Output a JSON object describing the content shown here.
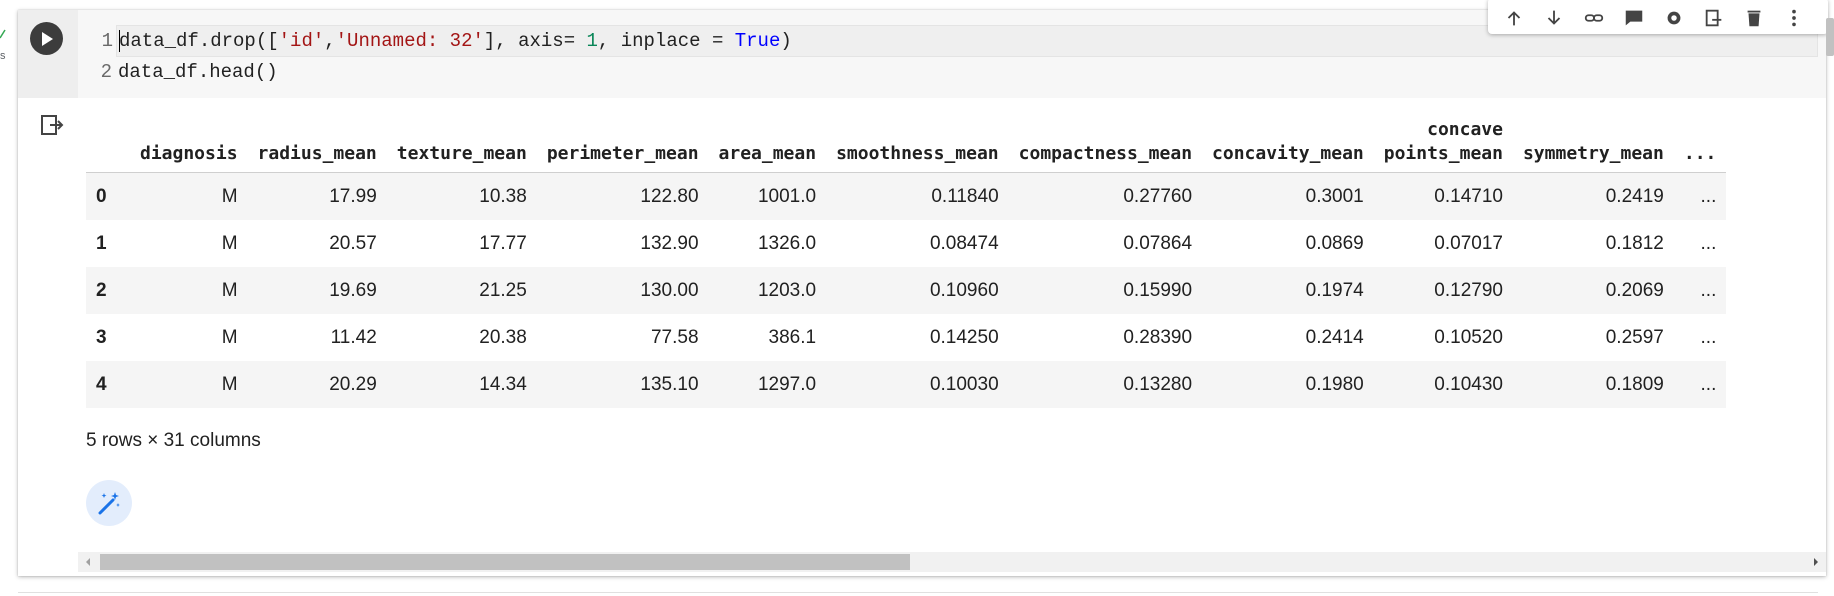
{
  "edge": {
    "text": "s"
  },
  "code": {
    "lines": [
      {
        "num": "1",
        "parts": [
          {
            "t": "data_df.drop([",
            "c": "plain"
          },
          {
            "t": "'id'",
            "c": "str"
          },
          {
            "t": ",",
            "c": "plain"
          },
          {
            "t": "'Unnamed: 32'",
            "c": "str"
          },
          {
            "t": "], axis= ",
            "c": "plain"
          },
          {
            "t": "1",
            "c": "num"
          },
          {
            "t": ", inplace = ",
            "c": "plain"
          },
          {
            "t": "True",
            "c": "kw"
          },
          {
            "t": ")",
            "c": "plain"
          }
        ]
      },
      {
        "num": "2",
        "parts": [
          {
            "t": "data_df.head()",
            "c": "plain"
          }
        ]
      }
    ]
  },
  "toolbar": {
    "icons": [
      "arrow-up-icon",
      "arrow-down-icon",
      "link-icon",
      "comment-icon",
      "gear-icon",
      "mirror-cell-icon",
      "delete-icon",
      "more-vert-icon"
    ]
  },
  "table": {
    "columns": [
      "",
      "diagnosis",
      "radius_mean",
      "texture_mean",
      "perimeter_mean",
      "area_mean",
      "smoothness_mean",
      "compactness_mean",
      "concavity_mean",
      "concave\npoints_mean",
      "symmetry_mean",
      "..."
    ],
    "rows": [
      [
        "0",
        "M",
        "17.99",
        "10.38",
        "122.80",
        "1001.0",
        "0.11840",
        "0.27760",
        "0.3001",
        "0.14710",
        "0.2419",
        "..."
      ],
      [
        "1",
        "M",
        "20.57",
        "17.77",
        "132.90",
        "1326.0",
        "0.08474",
        "0.07864",
        "0.0869",
        "0.07017",
        "0.1812",
        "..."
      ],
      [
        "2",
        "M",
        "19.69",
        "21.25",
        "130.00",
        "1203.0",
        "0.10960",
        "0.15990",
        "0.1974",
        "0.12790",
        "0.2069",
        "..."
      ],
      [
        "3",
        "M",
        "11.42",
        "20.38",
        "77.58",
        "386.1",
        "0.14250",
        "0.28390",
        "0.2414",
        "0.10520",
        "0.2597",
        "..."
      ],
      [
        "4",
        "M",
        "20.29",
        "14.34",
        "135.10",
        "1297.0",
        "0.10030",
        "0.13280",
        "0.1980",
        "0.10430",
        "0.1809",
        "..."
      ]
    ],
    "summary": "5 rows × 31 columns"
  },
  "scrollbar": {
    "thumb_fraction": 0.47
  }
}
